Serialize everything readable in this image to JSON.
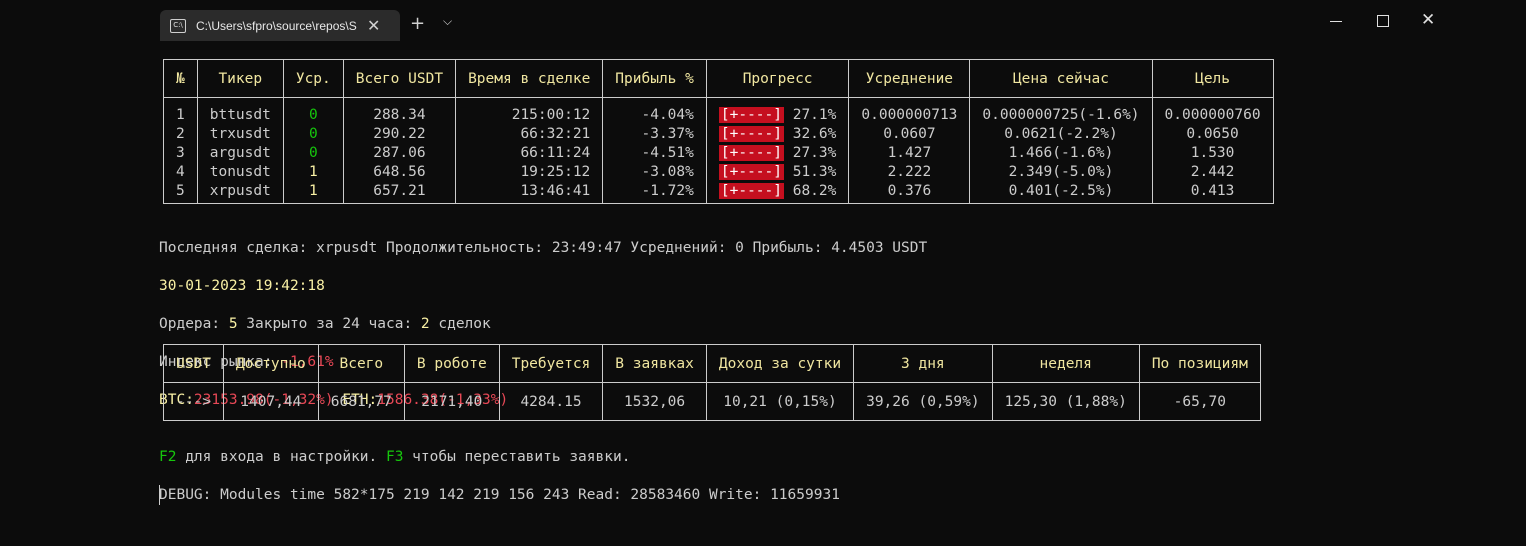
{
  "window": {
    "tab_title": "C:\\Users\\sfpro\\source\\repos\\S",
    "new_tab_label": "+",
    "dropdown_label": "⌵",
    "close_label": "✕"
  },
  "positions": {
    "headers": [
      "№",
      "Тикер",
      "Уср.",
      "Всего USDT",
      "Время в сделке",
      "Прибыль %",
      "Прогресс",
      "Усреднение",
      "Цена сейчас",
      "Цель"
    ],
    "rows": [
      {
        "n": "1",
        "ticker": "bttusdt",
        "avg": "0",
        "total": "288.34",
        "time": "215:00:12",
        "profit": "-4.04%",
        "bar": "[+----]",
        "progress": "27.1%",
        "averaging": "0.000000713",
        "price": "0.000000725(-1.6%)",
        "target": "0.000000760"
      },
      {
        "n": "2",
        "ticker": "trxusdt",
        "avg": "0",
        "total": "290.22",
        "time": "66:32:21",
        "profit": "-3.37%",
        "bar": "[+----]",
        "progress": "32.6%",
        "averaging": "0.0607",
        "price": "0.0621(-2.2%)",
        "target": "0.0650"
      },
      {
        "n": "3",
        "ticker": "argusdt",
        "avg": "0",
        "total": "287.06",
        "time": "66:11:24",
        "profit": "-4.51%",
        "bar": "[+----]",
        "progress": "27.3%",
        "averaging": "1.427",
        "price": "1.466(-1.6%)",
        "target": "1.530"
      },
      {
        "n": "4",
        "ticker": "tonusdt",
        "avg": "1",
        "total": "648.56",
        "time": "19:25:12",
        "profit": "-3.08%",
        "bar": "[+----]",
        "progress": "51.3%",
        "averaging": "2.222",
        "price": "2.349(-5.0%)",
        "target": "2.442"
      },
      {
        "n": "5",
        "ticker": "xrpusdt",
        "avg": "1",
        "total": "657.21",
        "time": "13:46:41",
        "profit": "-1.72%",
        "bar": "[+----]",
        "progress": "68.2%",
        "averaging": "0.376",
        "price": "0.401(-2.5%)",
        "target": "0.413"
      }
    ]
  },
  "status": {
    "last_deal": "Последняя сделка: xrpusdt Продолжительность: 23:49:47 Усреднений: 0 Прибыль: 4.4503 USDT",
    "datetime": "30-01-2023 19:42:18",
    "orders_label": "Ордера: ",
    "orders_count": "5",
    "closed_label": " Закрыто за 24 часа: ",
    "closed_count": "2",
    "deals_label": " сделок",
    "market_label": "Индекс рынка: ",
    "market_value": "-1,61%",
    "btc_label": "BTC:",
    "btc_value": "23153.98(-1,32%)",
    "eth_label": " ETH:",
    "eth_value": "1586.38(-1,33%)"
  },
  "balance": {
    "headers": [
      "USDT",
      "Доступно",
      "Всего",
      "В роботе",
      "Требуется",
      "В заявках",
      "Доход за сутки",
      "3 дня",
      "неделя",
      "По позициям"
    ],
    "values": [
      "--->",
      "1407,44",
      "6681,77",
      "2171,40",
      "4284.15",
      "1532,06",
      "10,21 (0,15%)",
      "39,26 (0,59%)",
      "125,30 (1,88%)",
      "-65,70"
    ]
  },
  "footer": {
    "f2_key": "F2",
    "f2_text": " для входа в настройки. ",
    "f3_key": "F3",
    "f3_text": " чтобы переставить заявки.",
    "debug": "DEBUG: Modules time 582*175 219 142 219 156 243 Read: 28583460 Write: 11659931"
  },
  "colors": {
    "background": "#0c0c0c",
    "header_text": "#f0e6a0",
    "green": "#16c60c",
    "yellow": "#f9f1a5",
    "red": "#e74856",
    "progress_bar": "#c50f1f"
  }
}
